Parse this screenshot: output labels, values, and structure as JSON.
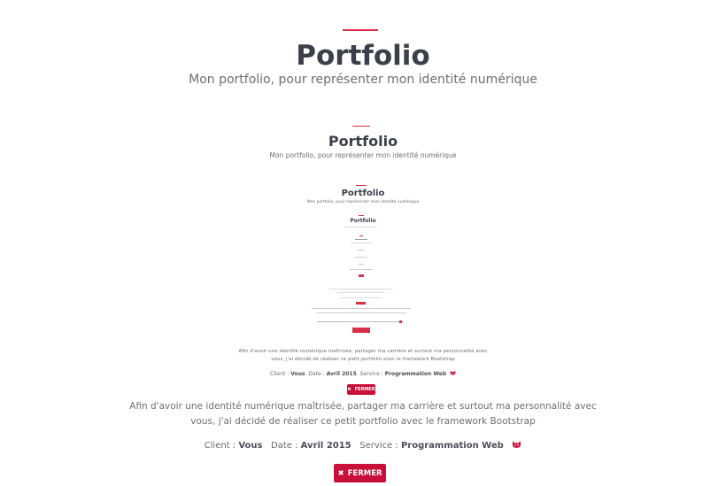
{
  "outer": {
    "title": "Portfolio",
    "subtitle": "Mon portfolio, pour représenter mon identité numérique",
    "description_line1": "Afin d'avoir une identité numérique maîtrisée, partager ma carrière et surtout ma personnalité avec",
    "description_line2": "vous, j'ai décidé de réaliser ce petit portfolio avec le framework Bootstrap",
    "client_label": "Client :",
    "client_value": "Vous",
    "date_label": "Date :",
    "date_value": "Avril 2015",
    "service_label": "Service :",
    "service_value": "Programmation Web",
    "close_label": "FERMER"
  },
  "mid": {
    "title": "Portfolio",
    "subtitle": "Mon portfolio, pour représenter mon identité numérique",
    "description_line1": "Afin d'avoir une identité numérique maîtrisée, partager ma carrière et surtout ma personnalité avec",
    "description_line2": "vous, j'ai décidé de réaliser ce petit portfolio avec le framework Bootstrap",
    "client_label": "Client :",
    "client_value": "Vous",
    "date_label": "Date :",
    "date_value": "Avril 2015",
    "service_label": "Service :",
    "service_value": "Programmation Web",
    "close_label": "FERMER"
  },
  "inner": {
    "title": "Portfolio",
    "subtitle": "Mon portfolio, pour représenter mon identité numérique",
    "description_line1": "Afin d'avoir une identité numérique maîtrisée, partager ma carrière et surtout ma personnalité avec",
    "description_line2": "vous, j'ai décidé de réaliser ce petit portfolio avec le framework Bootstrap",
    "client_label": "Client :",
    "client_value": "Vous",
    "date_label": "Date :",
    "date_value": "Avril 2015",
    "service_label": "Service :",
    "service_value": "Programmation Web",
    "close_label": "FERMER"
  },
  "innermost": {
    "title": "Portfolio"
  },
  "colors": {
    "accent": "#c8103a",
    "divider": "#d9304a",
    "title": "#3a3f4a"
  },
  "icons": {
    "close": "times-icon",
    "github": "github-icon"
  }
}
